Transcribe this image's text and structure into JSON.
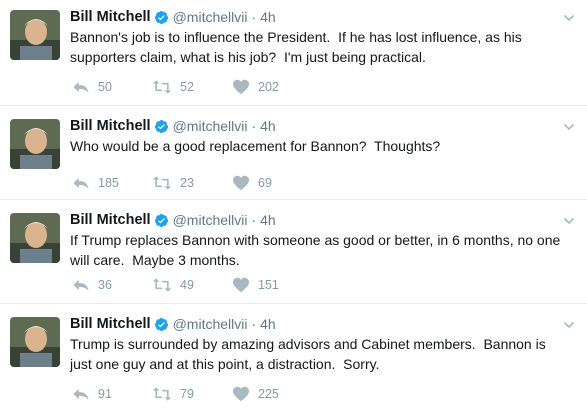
{
  "tweets": [
    {
      "name": "Bill Mitchell",
      "handle": "@mitchellvii",
      "dot": "·",
      "time": "4h",
      "text": "Bannon's job is to influence the President.  If he has lost influence, as his supporters claim, what is his job?  I'm just being practical.",
      "replies": "50",
      "retweets": "52",
      "likes": "202"
    },
    {
      "name": "Bill Mitchell",
      "handle": "@mitchellvii",
      "dot": "·",
      "time": "4h",
      "text": "Who would be a good replacement for Bannon?  Thoughts?",
      "replies": "185",
      "retweets": "23",
      "likes": "69"
    },
    {
      "name": "Bill Mitchell",
      "handle": "@mitchellvii",
      "dot": "·",
      "time": "4h",
      "text": "If Trump replaces Bannon with someone as good or better, in 6 months, no one will care.  Maybe 3 months.",
      "replies": "36",
      "retweets": "49",
      "likes": "151"
    },
    {
      "name": "Bill Mitchell",
      "handle": "@mitchellvii",
      "dot": "·",
      "time": "4h",
      "text": "Trump is surrounded by amazing advisors and Cabinet members.  Bannon is just one guy and at this point, a distraction.  Sorry.",
      "replies": "91",
      "retweets": "79",
      "likes": "225"
    }
  ],
  "icons": {
    "avatar": "avatar",
    "verified": "verified-badge-icon",
    "caret": "chevron-down-icon",
    "reply": "reply-icon",
    "retweet": "retweet-icon",
    "like": "heart-icon"
  },
  "colors": {
    "name": "#14171a",
    "meta": "#657786",
    "action": "#8899a6",
    "verified": "#1da1f2",
    "divider": "#e6ecf0"
  }
}
